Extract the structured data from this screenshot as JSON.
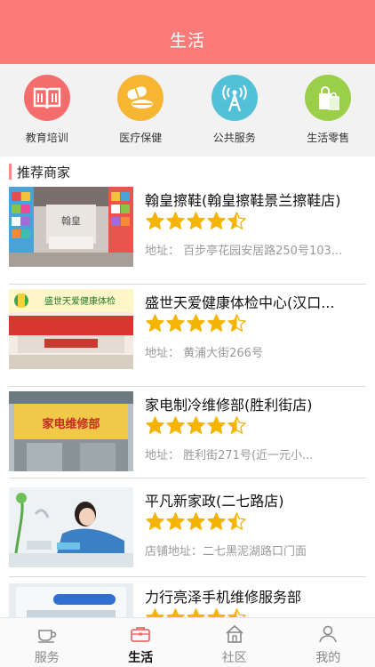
{
  "header": {
    "title": "生活"
  },
  "categories": [
    {
      "label": "教育培训",
      "icon": "book-icon",
      "color": "#f56c6c"
    },
    {
      "label": "医疗保健",
      "icon": "pills-icon",
      "color": "#f7b632"
    },
    {
      "label": "公共服务",
      "icon": "signal-tower-icon",
      "color": "#52c0d6"
    },
    {
      "label": "生活零售",
      "icon": "shopping-bag-icon",
      "color": "#9ccf49"
    }
  ],
  "section": {
    "title": "推荐商家"
  },
  "merchants": [
    {
      "name": "翰皇擦鞋(翰皇擦鞋景兰擦鞋店)",
      "rating": 4.5,
      "address": "地址： 百步亭花园安居路250号103...",
      "thumb_sign": "翰皇"
    },
    {
      "name": "盛世天爱健康体检中心(汉口...",
      "rating": 4.5,
      "address": "地址： 黄浦大街266号",
      "thumb_sign": "盛世天爱健康体检"
    },
    {
      "name": "家电制冷维修部(胜利街店)",
      "rating": 4.5,
      "address": "地址： 胜利街271号(近一元小...",
      "thumb_sign": "家电维修部"
    },
    {
      "name": "平凡新家政(二七路店)",
      "rating": 4.5,
      "address": "店铺地址：二七黑泥湖路口门面",
      "thumb_sign": ""
    },
    {
      "name": "力行亮泽手机维修服务部",
      "rating": 4.5,
      "address": "",
      "thumb_sign": ""
    }
  ],
  "tabs": [
    {
      "label": "服务",
      "icon": "cup-icon",
      "active": false
    },
    {
      "label": "生活",
      "icon": "briefcase-icon",
      "active": true
    },
    {
      "label": "社区",
      "icon": "house-icon",
      "active": false
    },
    {
      "label": "我的",
      "icon": "user-icon",
      "active": false
    }
  ],
  "colors": {
    "header": "#fb7b7b",
    "accent": "#fb8a86",
    "star": "#f5b400"
  }
}
